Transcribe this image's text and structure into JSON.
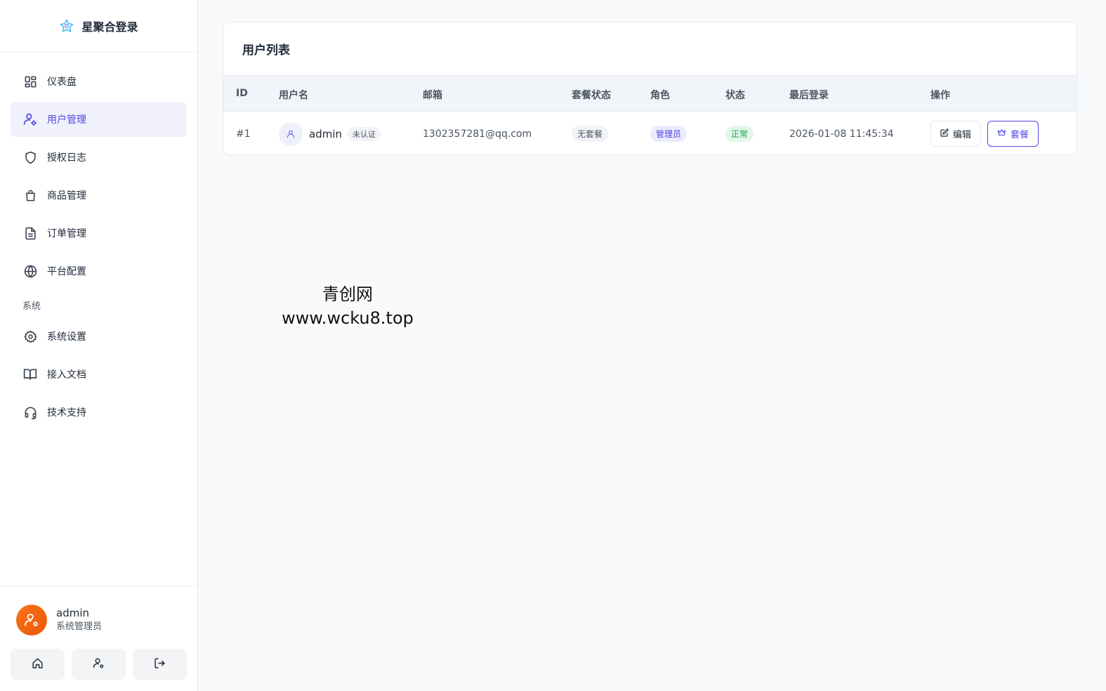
{
  "brand": {
    "title": "星聚合登录",
    "logo_icon": "star-icon"
  },
  "nav": [
    {
      "label": "仪表盘",
      "icon": "dashboard-icon",
      "active": false
    },
    {
      "label": "用户管理",
      "icon": "user-cog-icon",
      "active": true
    },
    {
      "label": "授权日志",
      "icon": "shield-icon",
      "active": false
    },
    {
      "label": "商品管理",
      "icon": "shopping-bag-icon",
      "active": false
    },
    {
      "label": "订单管理",
      "icon": "document-icon",
      "active": false
    },
    {
      "label": "平台配置",
      "icon": "globe-icon",
      "active": false
    }
  ],
  "section_label": "系统",
  "nav_system": [
    {
      "label": "系统设置",
      "icon": "gear-icon"
    },
    {
      "label": "接入文档",
      "icon": "book-icon"
    },
    {
      "label": "技术支持",
      "icon": "headset-icon"
    }
  ],
  "user": {
    "name": "admin",
    "role": "系统管理员"
  },
  "card": {
    "title": "用户列表",
    "columns": [
      "ID",
      "用户名",
      "邮箱",
      "套餐状态",
      "角色",
      "状态",
      "最后登录",
      "操作"
    ],
    "rows": [
      {
        "id": "#1",
        "username": "admin",
        "verify_badge": "未认证",
        "email": "1302357281@qq.com",
        "plan_status": "无套餐",
        "role": "管理员",
        "status": "正常",
        "last_login": "2026-01-08 11:45:34",
        "edit_label": "编辑",
        "plan_label": "套餐"
      }
    ]
  },
  "watermark": {
    "line1": "青创网",
    "line2": "www.wcku8.top"
  },
  "colors": {
    "accent": "#4f46e5",
    "avatar": "#f97316",
    "success": "#16a34a"
  }
}
